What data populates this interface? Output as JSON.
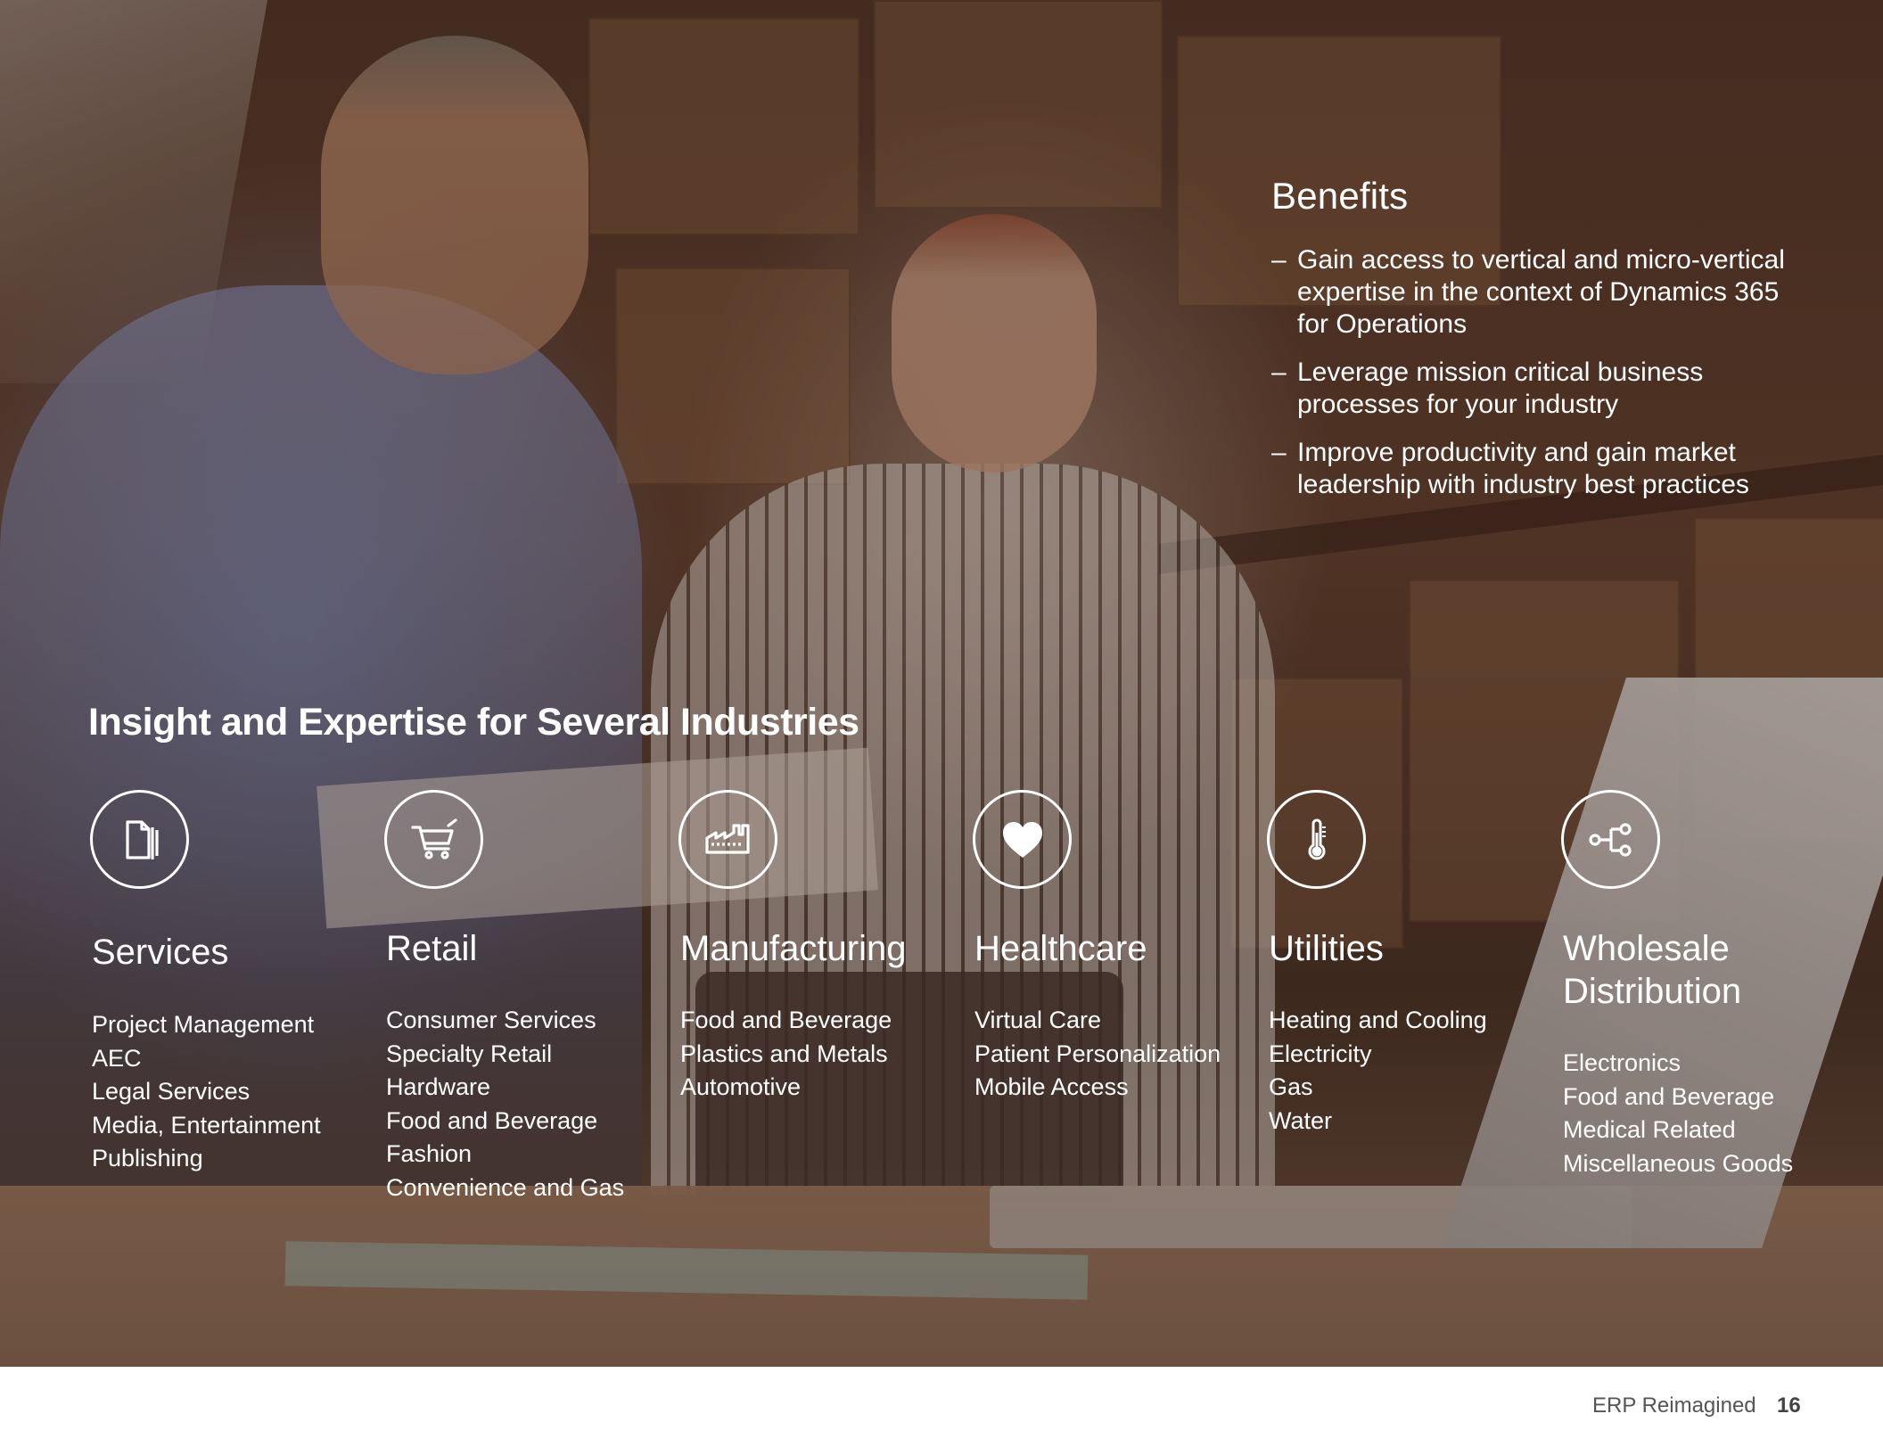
{
  "benefits": {
    "heading": "Benefits",
    "bullet_glyph": "–",
    "items": [
      "Gain access to vertical and micro-vertical expertise in the context of Dynamics 365 for Operations",
      "Leverage mission critical business processes for your industry",
      "Improve productivity and gain market leadership with industry best practices"
    ]
  },
  "headline": "Insight and Expertise for Several Industries",
  "industries": [
    {
      "icon": "documents-icon",
      "name": "Services",
      "items": [
        "Project Management",
        "AEC",
        "Legal Services",
        "Media, Entertainment",
        "Publishing"
      ]
    },
    {
      "icon": "shopping-cart-icon",
      "name": "Retail",
      "items": [
        "Consumer Services",
        "Specialty Retail",
        "Hardware",
        "Food and Beverage",
        "Fashion",
        "Convenience and Gas"
      ]
    },
    {
      "icon": "factory-icon",
      "name": "Manufacturing",
      "items": [
        "Food and Beverage",
        "Plastics and Metals",
        "Automotive"
      ]
    },
    {
      "icon": "heart-icon",
      "name": "Healthcare",
      "items": [
        "Virtual Care",
        "Patient Personalization",
        "Mobile Access"
      ]
    },
    {
      "icon": "thermometer-icon",
      "name": "Utilities",
      "items": [
        "Heating and Cooling",
        "Electricity",
        "Gas",
        "Water"
      ]
    },
    {
      "icon": "distribution-flow-icon",
      "name": "Wholesale Distribution",
      "items": [
        "Electronics",
        "Food and Beverage",
        "Medical Related",
        "Miscellaneous Goods"
      ]
    }
  ],
  "footer": {
    "title": "ERP Reimagined",
    "page_number": "16"
  },
  "colors": {
    "text": "#ffffff",
    "footer_text": "#555555",
    "page_bg": "#ffffff",
    "overlay": "#3a2519"
  }
}
